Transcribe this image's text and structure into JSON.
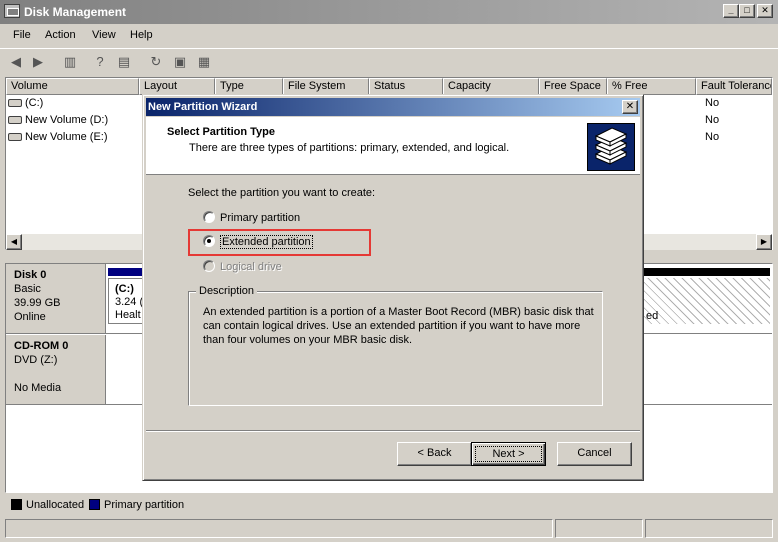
{
  "window": {
    "title": "Disk Management"
  },
  "menu": [
    "File",
    "Action",
    "View",
    "Help"
  ],
  "volume_list": {
    "columns": [
      "Volume",
      "Layout",
      "Type",
      "File System",
      "Status",
      "Capacity",
      "Free Space",
      "% Free",
      "Fault Tolerance"
    ],
    "rows": [
      {
        "name": "(C:)",
        "fault_tolerance": "No"
      },
      {
        "name": "New Volume (D:)",
        "fault_tolerance": "No"
      },
      {
        "name": "New Volume (E:)",
        "fault_tolerance": "No"
      }
    ]
  },
  "disks": [
    {
      "name": "Disk 0",
      "lines": [
        "Basic",
        "39.99 GB",
        "Online"
      ],
      "partition": {
        "label": "(C:)",
        "size": "3.24 (",
        "status": "Healt"
      },
      "right_fragment": "ed"
    },
    {
      "name": "CD-ROM 0",
      "lines": [
        "DVD (Z:)",
        "",
        "No Media"
      ]
    }
  ],
  "legend": [
    {
      "label": "Unallocated",
      "color": "#000000"
    },
    {
      "label": "Primary partition",
      "color": "#000080"
    }
  ],
  "dialog": {
    "title": "New Partition Wizard",
    "header_title": "Select Partition Type",
    "header_subtitle": "There are three types of partitions: primary, extended, and logical.",
    "prompt": "Select the partition you want to create:",
    "options": [
      {
        "label": "Primary partition",
        "selected": false,
        "enabled": true
      },
      {
        "label": "Extended partition",
        "selected": true,
        "enabled": true
      },
      {
        "label": "Logical drive",
        "selected": false,
        "enabled": false
      }
    ],
    "description_label": "Description",
    "description": "An extended partition is a portion of a Master Boot Record (MBR) basic disk that can contain logical drives. Use an extended partition if you want to have more than four volumes on your MBR basic disk.",
    "buttons": {
      "back": "< Back",
      "next": "Next >",
      "cancel": "Cancel"
    }
  },
  "colors": {
    "highlight": "#e53935",
    "dialog_title": "#0a246a",
    "primary_partition": "#000080"
  }
}
